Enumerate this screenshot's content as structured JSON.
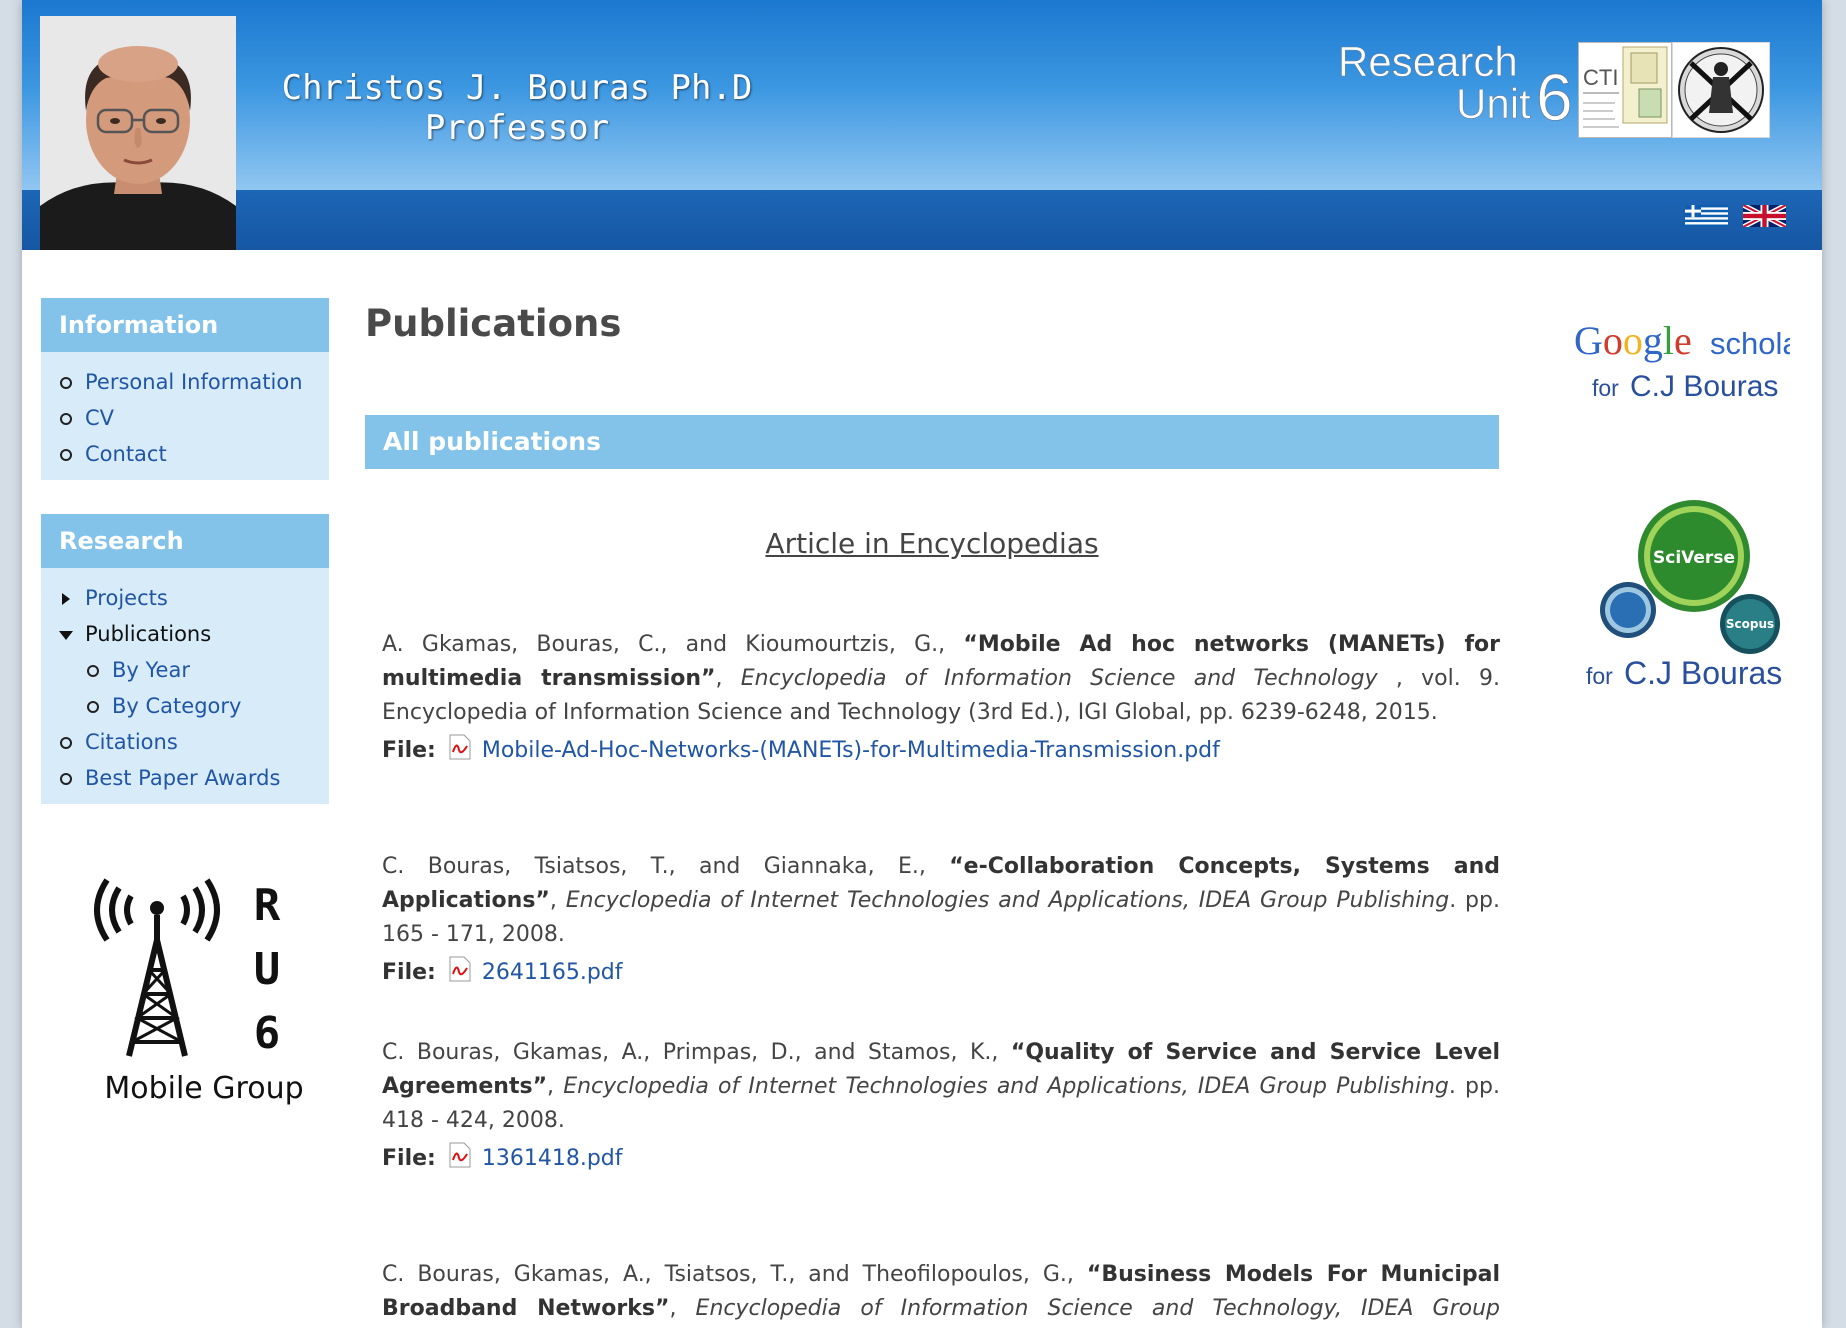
{
  "header": {
    "name_line1": "Christos J. Bouras Ph.D",
    "name_line2": "Professor",
    "ru6_text1": "Research",
    "ru6_text2": "Unit",
    "ru6_num": "6",
    "cti_text": "CTI",
    "languages": [
      "Greek",
      "English"
    ]
  },
  "sidebar": {
    "info": {
      "title": "Information",
      "items": [
        {
          "label": "Personal Information"
        },
        {
          "label": "CV"
        },
        {
          "label": "Contact"
        }
      ]
    },
    "research": {
      "title": "Research",
      "items": [
        {
          "label": "Projects"
        },
        {
          "label": "Publications"
        },
        {
          "label": "By Year"
        },
        {
          "label": "By Category"
        },
        {
          "label": "Citations"
        },
        {
          "label": "Best Paper Awards"
        }
      ]
    },
    "mobile_group": {
      "r": "R",
      "u": "U",
      "six": "6",
      "caption": "Mobile Group"
    }
  },
  "main": {
    "title": "Publications",
    "section_bar": "All publications",
    "section_title": "Article in Encyclopedias",
    "file_label": "File:",
    "pubs": [
      {
        "authors": "A. Gkamas, Bouras, C., and Kioumourtzis, G., ",
        "title": "“Mobile Ad hoc networks (MANETs) for multimedia transmission”",
        "venue": "Encyclopedia of Information Science and Technology",
        "rest": " , vol. 9. Encyclopedia of Information Science and Technology (3rd Ed.), IGI Global, pp. 6239-6248, 2015.",
        "file": "Mobile-Ad-Hoc-Networks-(MANETs)-for-Multimedia-Transmission.pdf"
      },
      {
        "authors": "C. Bouras, Tsiatsos, T., and Giannaka, E., ",
        "title": "“e-Collaboration Concepts, Systems and Applications”",
        "venue": "Encyclopedia of Internet Technologies and Applications, IDEA Group Publishing",
        "rest": ". pp. 165 - 171, 2008.",
        "file": "2641165.pdf"
      },
      {
        "authors": "C. Bouras, Gkamas, A., Primpas, D., and Stamos, K., ",
        "title": "“Quality of Service and Service Level Agreements”",
        "venue": "Encyclopedia of Internet Technologies and Applications, IDEA Group Publishing",
        "rest": ". pp. 418 - 424, 2008.",
        "file": "1361418.pdf"
      },
      {
        "authors": "C. Bouras, Gkamas, A., Tsiatsos, T., and Theofilopoulos, G., ",
        "title": "“Business Models For Municipal Broadband Networks”",
        "venue": "Encyclopedia of Information Science and Technology, IDEA Group Publishing.",
        "rest": "",
        "file": ""
      }
    ]
  },
  "right": {
    "google_word": "Google",
    "scholar_word": "scholar",
    "for_word": "for",
    "owner": "C.J Bouras",
    "sciverse": "SciVerse",
    "scopus": "Scopus"
  },
  "colors": {
    "header_blue": "#1b78cf",
    "sidebar_head": "#83c3ea",
    "sidebar_bg": "#d8ebf9",
    "link": "#2056a5"
  }
}
